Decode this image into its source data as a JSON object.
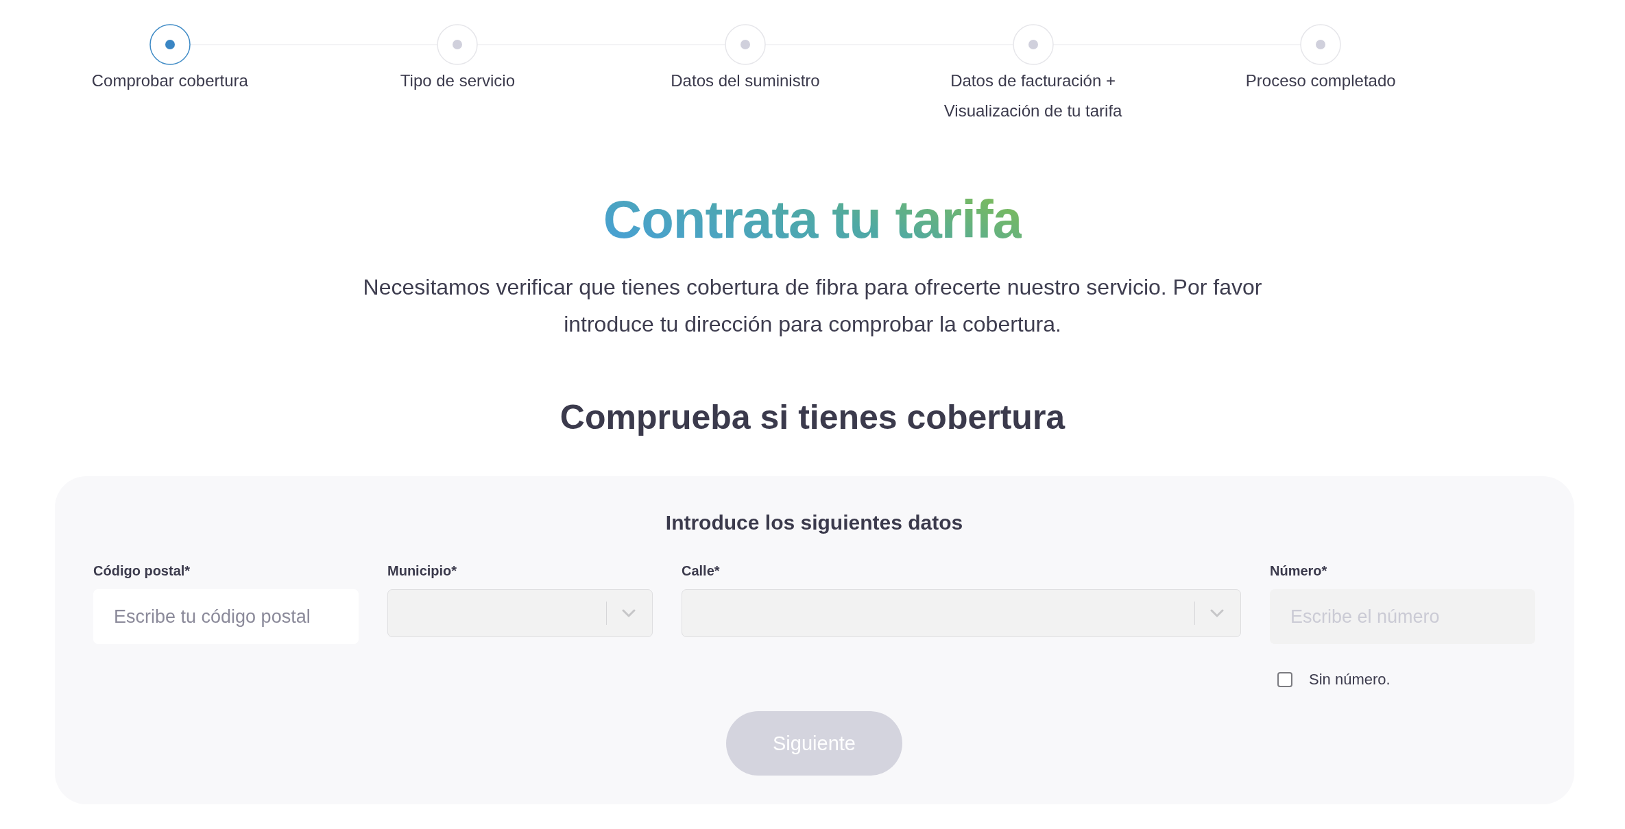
{
  "steps": [
    {
      "label": "Comprobar cobertura",
      "selected": true
    },
    {
      "label": "Tipo de servicio",
      "selected": false
    },
    {
      "label": "Datos del suministro",
      "selected": false
    },
    {
      "label": "Datos de facturación + Visualización de tu tarifa",
      "selected": false
    },
    {
      "label": "Proceso completado",
      "selected": false
    }
  ],
  "title": "Contrata tu tarifa",
  "intro": "Necesitamos verificar que tienes cobertura de fibra para ofrecerte nuestro servicio. Por favor introduce tu dirección para comprobar la cobertura.",
  "section_heading": "Comprueba si tienes cobertura",
  "form": {
    "title": "Introduce los siguientes datos",
    "fields": [
      {
        "kind": "text",
        "label": "Código postal*",
        "placeholder": "Escribe tu código postal",
        "disabled": false
      },
      {
        "kind": "select",
        "label": "Municipio*",
        "disabled": true
      },
      {
        "kind": "select",
        "label": "Calle*",
        "disabled": true
      },
      {
        "kind": "text",
        "label": "Número*",
        "placeholder": "Escribe el número",
        "disabled": true,
        "option": {
          "label": "Sin número.",
          "checked": false
        }
      }
    ],
    "submit": {
      "label": "Siguiente",
      "disabled": true
    }
  }
}
